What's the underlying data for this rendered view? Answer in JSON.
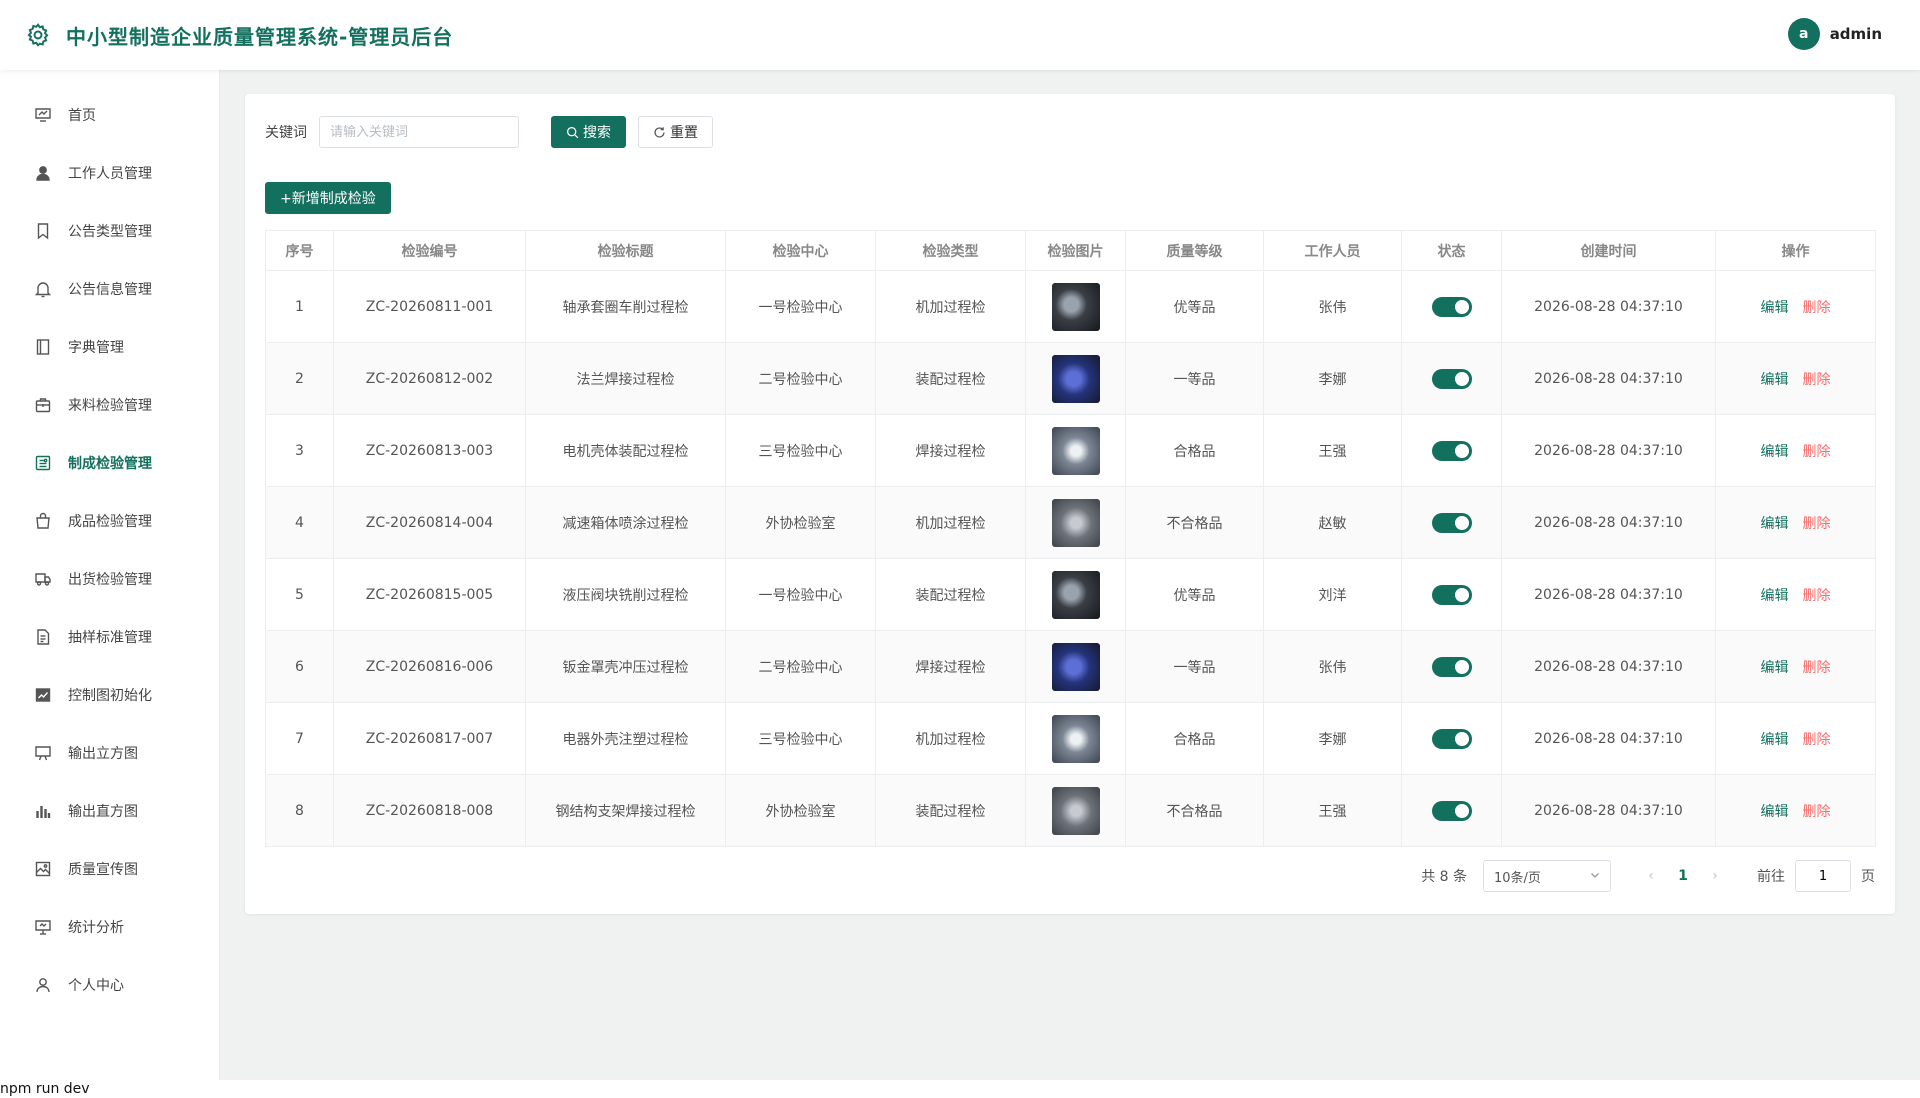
{
  "header": {
    "title": "中小型制造企业质量管理系统-管理员后台",
    "avatar_letter": "a",
    "username": "admin"
  },
  "sidebar": {
    "items": [
      {
        "label": "首页",
        "icon": "dashboard-icon",
        "active": false
      },
      {
        "label": "工作人员管理",
        "icon": "user-icon",
        "active": false
      },
      {
        "label": "公告类型管理",
        "icon": "bookmark-icon",
        "active": false
      },
      {
        "label": "公告信息管理",
        "icon": "bell-icon",
        "active": false
      },
      {
        "label": "字典管理",
        "icon": "notebook-icon",
        "active": false
      },
      {
        "label": "来料检验管理",
        "icon": "briefcase-icon",
        "active": false
      },
      {
        "label": "制成检验管理",
        "icon": "postcard-icon",
        "active": true
      },
      {
        "label": "成品检验管理",
        "icon": "bag-icon",
        "active": false
      },
      {
        "label": "出货检验管理",
        "icon": "truck-icon",
        "active": false
      },
      {
        "label": "抽样标准管理",
        "icon": "document-icon",
        "active": false
      },
      {
        "label": "控制图初始化",
        "icon": "data-line-icon",
        "active": false
      },
      {
        "label": "输出立方图",
        "icon": "monitor-icon",
        "active": false
      },
      {
        "label": "输出直方图",
        "icon": "histogram-icon",
        "active": false
      },
      {
        "label": "质量宣传图",
        "icon": "picture-icon",
        "active": false
      },
      {
        "label": "统计分析",
        "icon": "data-board-icon",
        "active": false
      },
      {
        "label": "个人中心",
        "icon": "avatar-icon",
        "active": false
      }
    ]
  },
  "search": {
    "label": "关键词",
    "placeholder": "请输入关键词",
    "value": "",
    "search_label": "搜索",
    "reset_label": "重置"
  },
  "toolbar": {
    "add_label": "+新增制成检验"
  },
  "table": {
    "columns": [
      "序号",
      "检验编号",
      "检验标题",
      "检验中心",
      "检验类型",
      "检验图片",
      "质量等级",
      "工作人员",
      "状态",
      "创建时间",
      "操作"
    ],
    "edit_label": "编辑",
    "delete_label": "删除",
    "rows": [
      {
        "idx": "1",
        "code": "ZC-20260811-001",
        "title": "轴承套圈车削过程检",
        "center": "一号检验中心",
        "type": "机加过程检",
        "grade": "优等品",
        "staff": "张伟",
        "status": true,
        "created": "2026-08-28 04:37:10",
        "img": "dark"
      },
      {
        "idx": "2",
        "code": "ZC-20260812-002",
        "title": "法兰焊接过程检",
        "center": "二号检验中心",
        "type": "装配过程检",
        "grade": "一等品",
        "staff": "李娜",
        "status": true,
        "created": "2026-08-28 04:37:10",
        "img": "blue"
      },
      {
        "idx": "3",
        "code": "ZC-20260813-003",
        "title": "电机壳体装配过程检",
        "center": "三号检验中心",
        "type": "焊接过程检",
        "grade": "合格品",
        "staff": "王强",
        "status": true,
        "created": "2026-08-28 04:37:10",
        "img": "steel"
      },
      {
        "idx": "4",
        "code": "ZC-20260814-004",
        "title": "减速箱体喷涂过程检",
        "center": "外协检验室",
        "type": "机加过程检",
        "grade": "不合格品",
        "staff": "赵敏",
        "status": true,
        "created": "2026-08-28 04:37:10",
        "img": "gray"
      },
      {
        "idx": "5",
        "code": "ZC-20260815-005",
        "title": "液压阀块铣削过程检",
        "center": "一号检验中心",
        "type": "装配过程检",
        "grade": "优等品",
        "staff": "刘洋",
        "status": true,
        "created": "2026-08-28 04:37:10",
        "img": "dark"
      },
      {
        "idx": "6",
        "code": "ZC-20260816-006",
        "title": "钣金罩壳冲压过程检",
        "center": "二号检验中心",
        "type": "焊接过程检",
        "grade": "一等品",
        "staff": "张伟",
        "status": true,
        "created": "2026-08-28 04:37:10",
        "img": "blue"
      },
      {
        "idx": "7",
        "code": "ZC-20260817-007",
        "title": "电器外壳注塑过程检",
        "center": "三号检验中心",
        "type": "机加过程检",
        "grade": "合格品",
        "staff": "李娜",
        "status": true,
        "created": "2026-08-28 04:37:10",
        "img": "steel"
      },
      {
        "idx": "8",
        "code": "ZC-20260818-008",
        "title": "钢结构支架焊接过程检",
        "center": "外协检验室",
        "type": "装配过程检",
        "grade": "不合格品",
        "staff": "王强",
        "status": true,
        "created": "2026-08-28 04:37:10",
        "img": "gray"
      }
    ]
  },
  "pagination": {
    "total_text": "共 8 条",
    "page_size": "10条/页",
    "current_page": "1",
    "goto_label": "前往",
    "goto_value": "1",
    "page_suffix": "页"
  },
  "terminal": {
    "text": "npm run dev"
  },
  "colors": {
    "accent": "#13705e",
    "danger": "#f56c6c"
  }
}
